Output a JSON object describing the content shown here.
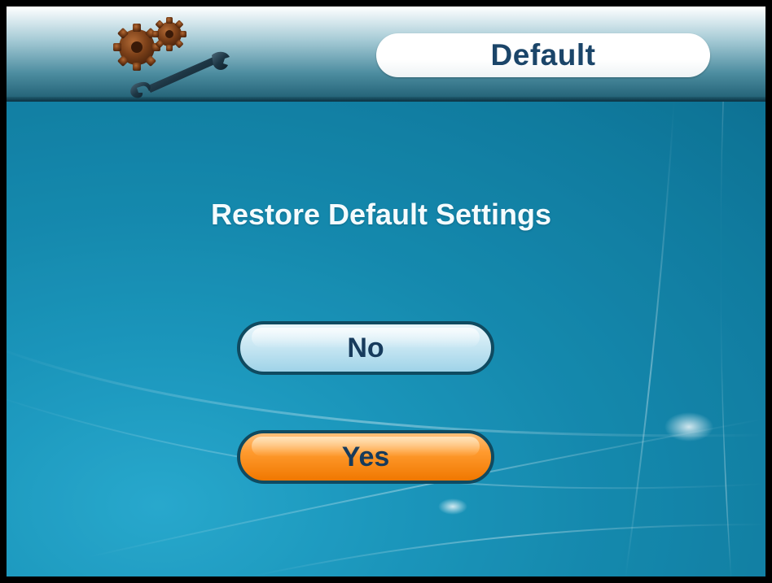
{
  "header": {
    "title": "Default",
    "icon": "gears-wrench-icon"
  },
  "dialog": {
    "heading": "Restore Default Settings",
    "buttons": {
      "no_label": "No",
      "yes_label": "Yes",
      "selected": "Yes"
    }
  },
  "colors": {
    "header_dark": "#1e5d72",
    "title_text": "#1b4569",
    "body_background": "#178fb4",
    "button_no": "#c9e7f3",
    "button_yes": "#ff9a2e",
    "button_border": "#0f4a60",
    "gear": "#6b3a1a",
    "wrench": "#1d3644"
  }
}
